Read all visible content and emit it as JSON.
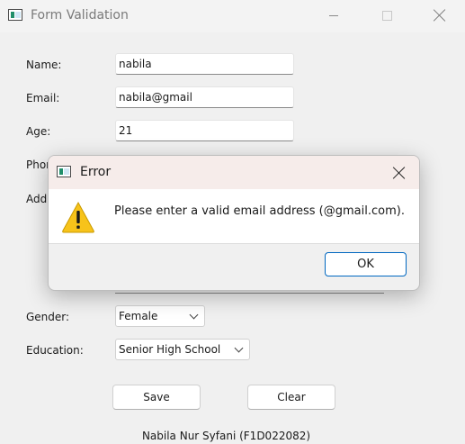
{
  "window": {
    "title": "Form Validation",
    "icon": "app-window-icon"
  },
  "form": {
    "name_label": "Name:",
    "name_value": "nabila",
    "email_label": "Email:",
    "email_value": "nabila@gmail",
    "age_label": "Age:",
    "age_value": "21",
    "phone_label_visible": "Phon",
    "address_label_visible": "Addr",
    "gender_label": "Gender:",
    "gender_value": "Female",
    "education_label": "Education:",
    "education_value": "Senior High School",
    "save_label": "Save",
    "clear_label": "Clear"
  },
  "footer": {
    "text": "Nabila Nur Syfani (F1D022082)"
  },
  "dialog": {
    "title": "Error",
    "message": "Please enter a valid email address (@gmail.com).",
    "ok_label": "OK",
    "icon": "warning-icon"
  },
  "colors": {
    "dialog_title_bg": "#f6ecea",
    "ok_border": "#0067c0",
    "warning_yellow": "#f7c31a"
  }
}
